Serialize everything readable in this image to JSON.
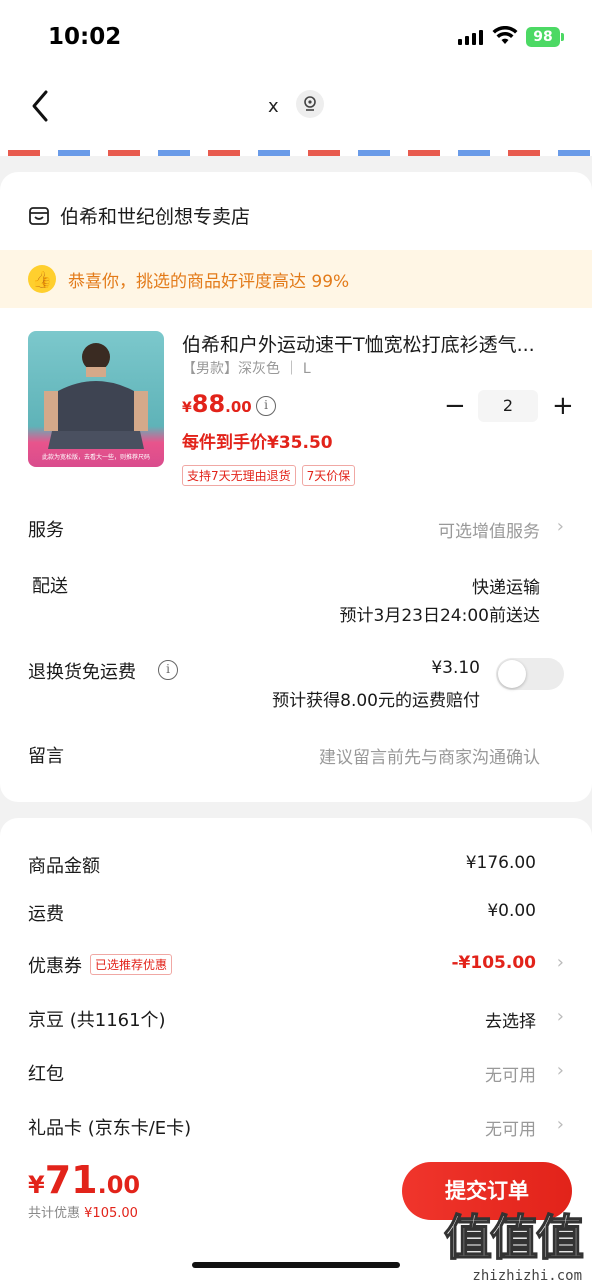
{
  "status_bar": {
    "time": "10:02",
    "battery": "98"
  },
  "nav": {
    "close_label": "x"
  },
  "shop": {
    "name": "伯希和世纪创想专卖店"
  },
  "praise": {
    "text": "恭喜你，挑选的商品好评度高达 99%"
  },
  "product": {
    "image_caption": "此款为宽松版，去看大一些，则推荐尺码",
    "title": "伯希和户外运动速干T恤宽松打底衫透气...",
    "spec": "【男款】深灰色 ｜ L",
    "price_currency": "¥",
    "price_int": "88",
    "price_dec": ".00",
    "quantity": "2",
    "unit_price_text": "每件到手价¥35.50",
    "tags": [
      "支持7天无理由退货",
      "7天价保"
    ]
  },
  "rows": {
    "service": {
      "label": "服务",
      "value": "可选增值服务"
    },
    "delivery": {
      "label": "配送",
      "method": "快递运输",
      "eta": "预计3月23日24:00前送达"
    },
    "return_shipping": {
      "label": "退换货免运费",
      "price": "¥3.10",
      "note": "预计获得8.00元的运费赔付",
      "enabled": false
    },
    "message": {
      "label": "留言",
      "placeholder": "建议留言前先与商家沟通确认"
    }
  },
  "summary": {
    "goods_amount": {
      "label": "商品金额",
      "value": "¥176.00"
    },
    "shipping_fee": {
      "label": "运费",
      "value": "¥0.00"
    },
    "coupon": {
      "label": "优惠券",
      "badge": "已选推荐优惠",
      "value": "-¥105.00"
    },
    "jingdou": {
      "label": "京豆 (共1161个)",
      "value": "去选择"
    },
    "red_packet": {
      "label": "红包",
      "value": "无可用"
    },
    "gift_card": {
      "label": "礼品卡 (京东卡/E卡)",
      "value": "无可用"
    }
  },
  "bottom": {
    "total_currency": "¥",
    "total_int": "71",
    "total_dec": ".00",
    "discount_label": "共计优惠",
    "discount_value": "¥105.00",
    "submit_label": "提交订单"
  },
  "watermark": {
    "logo": "值值值",
    "url": "zhizhizhi.com"
  },
  "colors": {
    "accent": "#e2231a",
    "praise_text": "#e37b1a",
    "praise_bg": "#fff6e5"
  }
}
